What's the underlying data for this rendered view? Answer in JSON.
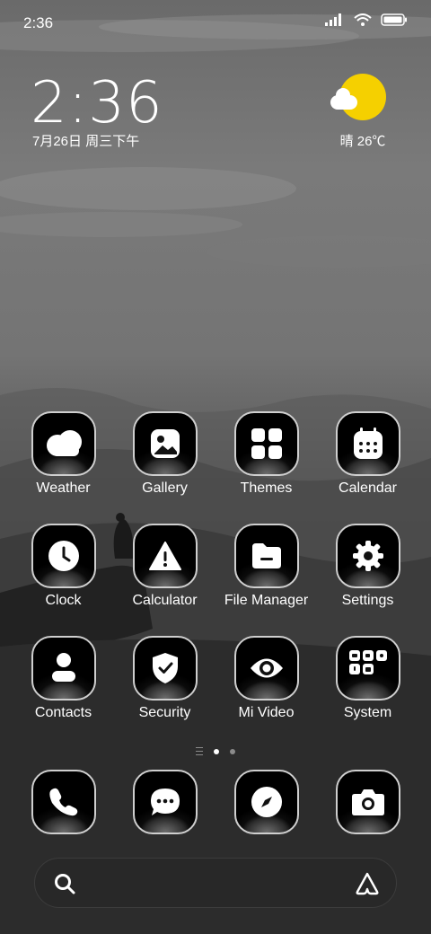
{
  "status_bar": {
    "time": "2:36"
  },
  "lock_clock": {
    "time": "2:36",
    "date": "7月26日 周三下午"
  },
  "weather_widget": {
    "text": "晴 26℃"
  },
  "apps": [
    {
      "label": "Weather",
      "icon": "weather-cloud-icon"
    },
    {
      "label": "Gallery",
      "icon": "gallery-icon"
    },
    {
      "label": "Themes",
      "icon": "themes-grid-icon"
    },
    {
      "label": "Calendar",
      "icon": "calendar-icon"
    },
    {
      "label": "Clock",
      "icon": "clock-icon"
    },
    {
      "label": "Calculator",
      "icon": "warning-triangle-icon"
    },
    {
      "label": "File Manager",
      "icon": "folder-icon"
    },
    {
      "label": "Settings",
      "icon": "gear-icon"
    },
    {
      "label": "Contacts",
      "icon": "person-icon"
    },
    {
      "label": "Security",
      "icon": "shield-check-icon"
    },
    {
      "label": "Mi Video",
      "icon": "eye-icon"
    },
    {
      "label": "System",
      "icon": "system-folder-icon"
    }
  ],
  "dock": [
    {
      "icon": "phone-icon"
    },
    {
      "icon": "message-icon"
    },
    {
      "icon": "compass-icon"
    },
    {
      "icon": "camera-icon"
    }
  ],
  "page_indicator": {
    "pages": 2,
    "current": 1
  },
  "colors": {
    "sun": "#f5d000",
    "icon_border": "#cfcfcf"
  }
}
